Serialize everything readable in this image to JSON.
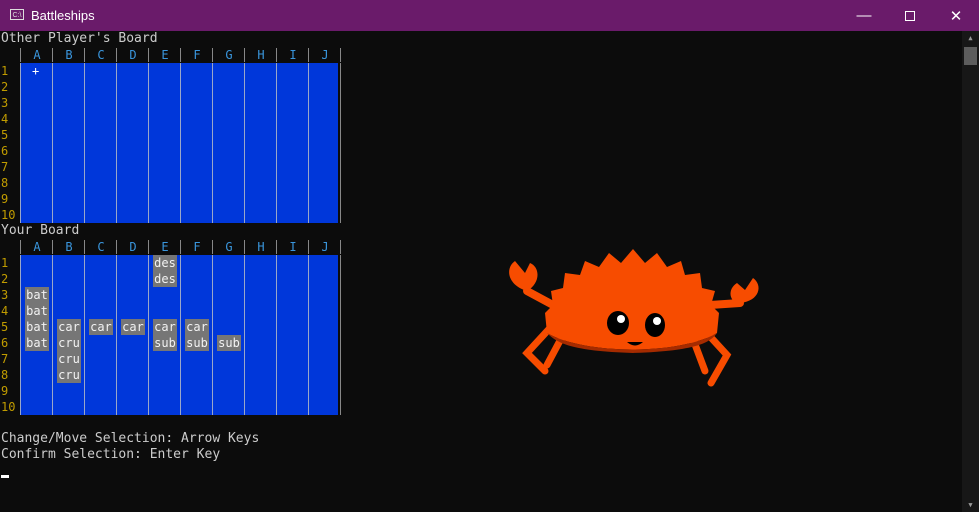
{
  "window": {
    "title": "Battleships",
    "icon": "console-icon"
  },
  "lines": {
    "other_board": "Other Player's Board",
    "your_board": "Your Board",
    "help1": "Change/Move Selection: Arrow Keys",
    "help2": "Confirm Selection: Enter Key"
  },
  "columns": [
    "A",
    "B",
    "C",
    "D",
    "E",
    "F",
    "G",
    "H",
    "I",
    "J"
  ],
  "rows": [
    "1",
    "2",
    "3",
    "4",
    "5",
    "6",
    "7",
    "8",
    "9",
    "10"
  ],
  "cursor": {
    "symbol": "+",
    "row": 0,
    "col": 0
  },
  "ships": [
    {
      "row": 0,
      "col": 4,
      "label": "des"
    },
    {
      "row": 1,
      "col": 4,
      "label": "des"
    },
    {
      "row": 2,
      "col": 0,
      "label": "bat"
    },
    {
      "row": 3,
      "col": 0,
      "label": "bat"
    },
    {
      "row": 4,
      "col": 0,
      "label": "bat"
    },
    {
      "row": 5,
      "col": 0,
      "label": "bat"
    },
    {
      "row": 4,
      "col": 1,
      "label": "car"
    },
    {
      "row": 4,
      "col": 2,
      "label": "car"
    },
    {
      "row": 4,
      "col": 3,
      "label": "car"
    },
    {
      "row": 4,
      "col": 4,
      "label": "car"
    },
    {
      "row": 4,
      "col": 5,
      "label": "car"
    },
    {
      "row": 5,
      "col": 1,
      "label": "cru"
    },
    {
      "row": 6,
      "col": 1,
      "label": "cru"
    },
    {
      "row": 7,
      "col": 1,
      "label": "cru"
    },
    {
      "row": 5,
      "col": 4,
      "label": "sub"
    },
    {
      "row": 5,
      "col": 5,
      "label": "sub"
    },
    {
      "row": 5,
      "col": 6,
      "label": "sub"
    }
  ],
  "colors": {
    "water": "#0037da",
    "ship": "#767676",
    "column_label": "#3a96dd",
    "row_label": "#c19c00",
    "crab": "#f74c00"
  }
}
